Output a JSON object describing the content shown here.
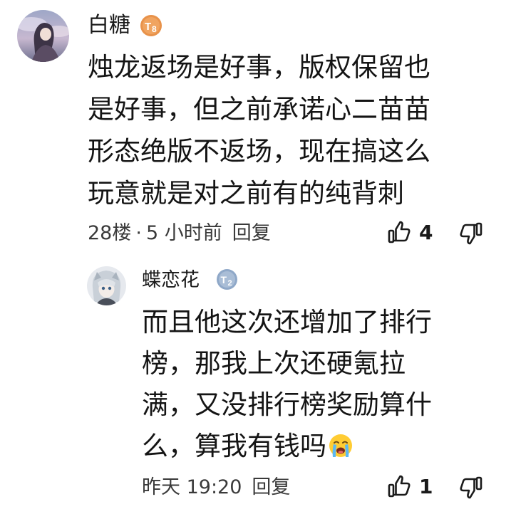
{
  "main_comment": {
    "username": "白糖",
    "level_badge_text": "8",
    "text_lines": [
      "烛龙返场是好事，版权保留也",
      "是好事，但之前承诺心二苗苗",
      "形态绝版不返场，现在搞这么",
      "玩意就是对之前有的纯背刺"
    ],
    "floor": "28楼",
    "separator": "·",
    "time": "5 小时前",
    "reply_label": "回复",
    "like_count": "4",
    "badge_color": "#e8924a"
  },
  "reply_comment": {
    "username": "蝶恋花",
    "level_badge_text": "2",
    "text_lines": [
      "而且他这次还增加了排行",
      "榜，那我上次还硬氪拉",
      "满，又没排行榜奖励算什",
      "么，算我有钱吗"
    ],
    "emoji": "loudly-crying-face-emoji",
    "time": "昨天 19:20",
    "reply_label": "回复",
    "like_count": "1",
    "badge_color": "#8fa8c8"
  },
  "icons": {
    "like": "thumbs-up-icon",
    "dislike": "thumbs-down-icon"
  }
}
